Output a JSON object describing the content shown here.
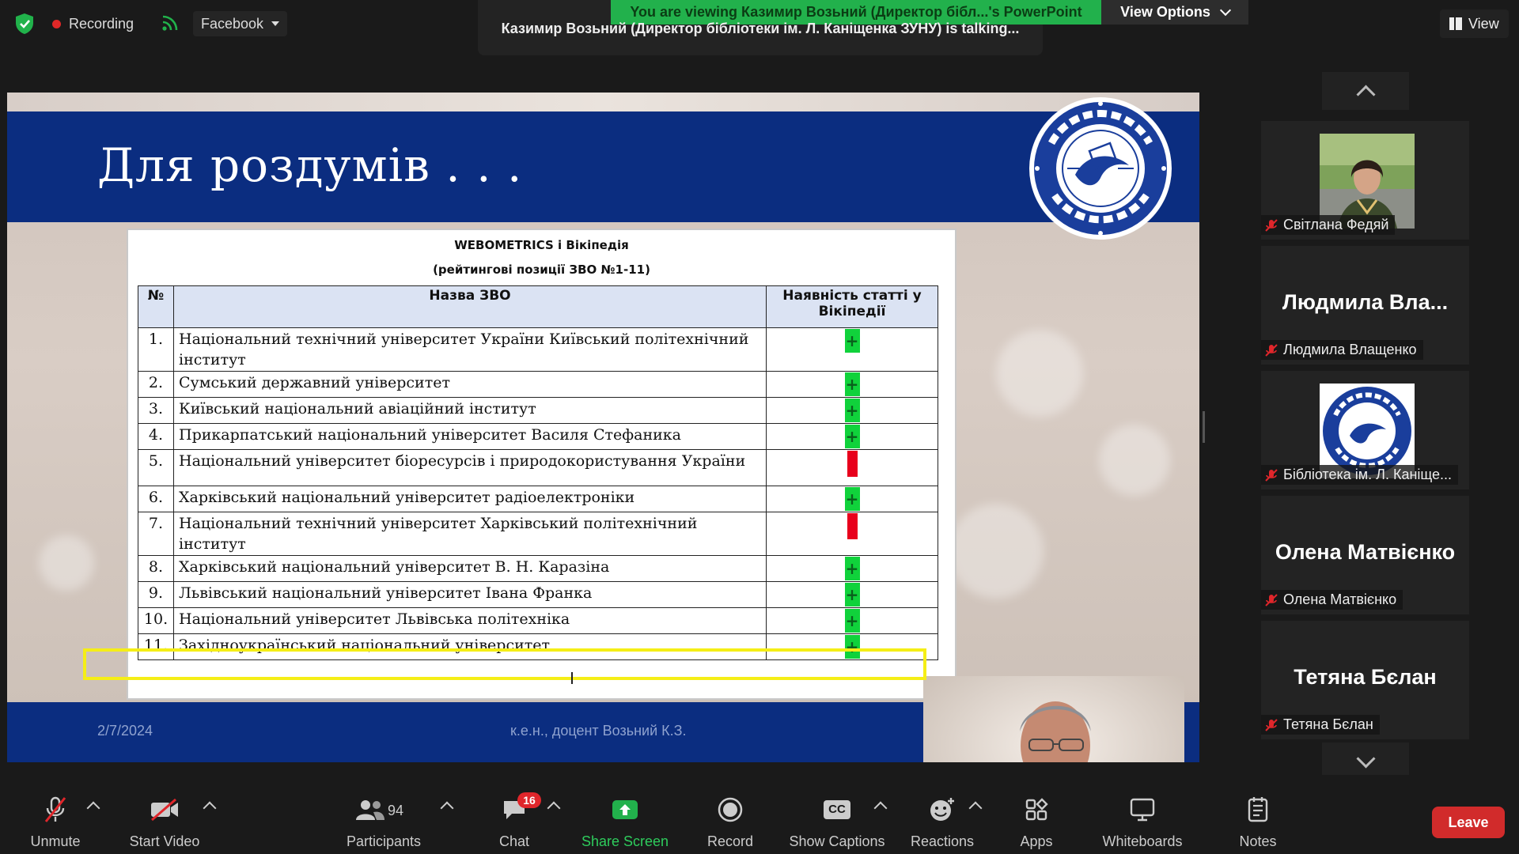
{
  "topbar": {
    "recording_label": "Recording",
    "stream_target": "Facebook",
    "viewing_banner": "You are viewing Казимир Возьний (Директор бібл...'s PowerPoint",
    "view_options_label": "View Options",
    "talking_text": "Казимир Возьний (Директор бібліотеки ім. Л. Каніщенка ЗУНУ) is talking...",
    "view_label": "View"
  },
  "slide": {
    "title": "Для роздумів  . . .",
    "date": "2/7/2024",
    "author": "к.е.н., доцент Возьний К.З.",
    "table_title": "WEBOMETRICS і Вікіпедія",
    "table_subtitle": "(рейтингові позиції ЗВО №1-11)",
    "columns": [
      "№",
      "Назва ЗВО",
      "Наявність статті у Вікіпедії"
    ],
    "rows": [
      {
        "num": "1.",
        "name": "Національний технічний університет України Київський політехнічний інститут",
        "has_article": true
      },
      {
        "num": "2.",
        "name": "Сумський державний університет",
        "has_article": true
      },
      {
        "num": "3.",
        "name": "Київський національний авіаційний інститут",
        "has_article": true
      },
      {
        "num": "4.",
        "name": "Прикарпатський національний університет Василя Стефаника",
        "has_article": true
      },
      {
        "num": "5.",
        "name": "Національний університет біоресурсів і природокористування України",
        "has_article": false
      },
      {
        "num": "6.",
        "name": "Харківський національний університет радіоелектроніки",
        "has_article": true
      },
      {
        "num": "7.",
        "name": "Національний технічний університет Харківський політехнічний інститут",
        "has_article": false
      },
      {
        "num": "8.",
        "name": "Харківський національний університет В. Н. Каразіна",
        "has_article": true
      },
      {
        "num": "9.",
        "name": "Львівський національний університет Івана Франка",
        "has_article": true
      },
      {
        "num": "10.",
        "name": " Національний університет Львівська політехніка",
        "has_article": true
      },
      {
        "num": "11.",
        "name": "Західноукраїнський національний університет",
        "has_article": true
      }
    ],
    "plus_symbol": "+",
    "highlighted_row": 11,
    "colors": {
      "header_blue": "#0b2d80",
      "yes": "#10d23b",
      "no": "#e8001c",
      "highlight": "#f5ee16"
    }
  },
  "participants_panel": [
    {
      "name": "Світлана Федяй",
      "type": "photo",
      "muted": true
    },
    {
      "name": "Людмила Влащенко",
      "display": "Людмила  Вла...",
      "type": "name",
      "muted": true
    },
    {
      "name": "Бібліотека ім. Л. Каніще...",
      "type": "logo",
      "muted": true
    },
    {
      "name": "Олена Матвієнко",
      "display": "Олена Матвієнко",
      "type": "name",
      "muted": true
    },
    {
      "name": "Тетяна Бєлан",
      "display": "Тетяна Бєлан",
      "type": "name",
      "muted": true
    }
  ],
  "toolbar": {
    "unmute": "Unmute",
    "start_video": "Start Video",
    "participants": "Participants",
    "participants_count": "94",
    "chat": "Chat",
    "chat_badge": "16",
    "share_screen": "Share Screen",
    "record": "Record",
    "show_captions": "Show Captions",
    "captions_icon": "CC",
    "reactions": "Reactions",
    "apps": "Apps",
    "whiteboards": "Whiteboards",
    "notes": "Notes",
    "leave": "Leave"
  }
}
